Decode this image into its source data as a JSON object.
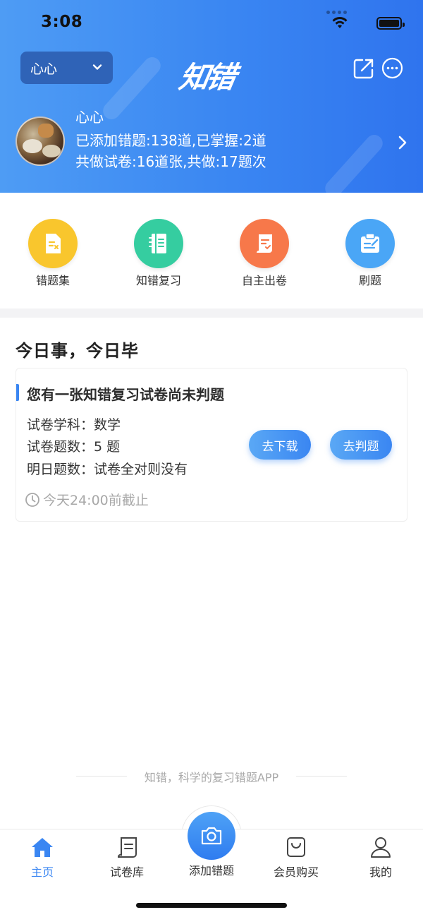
{
  "status_bar": {
    "time": "3:08"
  },
  "header": {
    "user_select_label": "心心",
    "logo_text": "知错",
    "username": "心心",
    "stats_line1": "已添加错题:138道,已掌握:2道",
    "stats_line2": "共做试卷:16道张,共做:17题次"
  },
  "quick_actions": [
    {
      "label": "错题集",
      "color": "#f9c62d"
    },
    {
      "label": "知错复习",
      "color": "#35cda0"
    },
    {
      "label": "自主出卷",
      "color": "#f7784a"
    },
    {
      "label": "刷题",
      "color": "#4aa6f6"
    }
  ],
  "today": {
    "title": "今日事，今日毕",
    "card": {
      "title": "您有一张知错复习试卷尚未判题",
      "subject": "试卷学科：数学",
      "count": "试卷题数：5 题",
      "tomorrow": "明日题数：试卷全对则没有",
      "deadline": "今天24:00前截止",
      "download_label": "去下载",
      "grade_label": "去判题"
    }
  },
  "slogan": "知错，科学的复习错题APP",
  "tabbar": {
    "home": "主页",
    "papers": "试卷库",
    "add": "添加错题",
    "vip": "会员购买",
    "me": "我的"
  },
  "colors": {
    "accent": "#3a86f2",
    "header_start": "#4e9cf4",
    "header_end": "#2f74ee"
  }
}
